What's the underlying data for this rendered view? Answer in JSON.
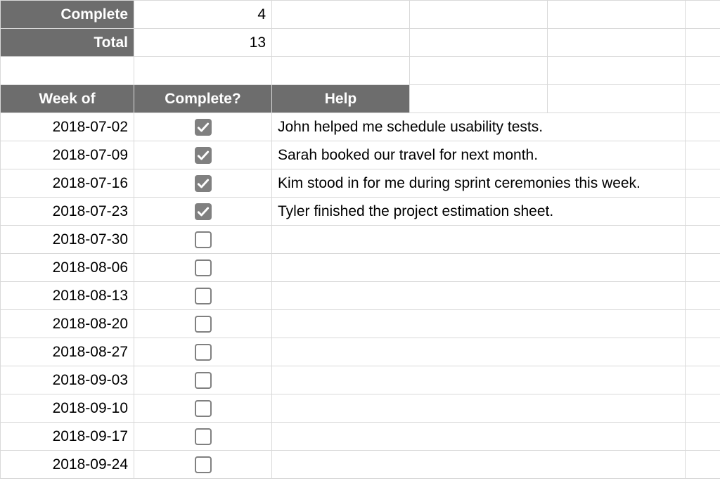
{
  "summary": {
    "complete_label": "Complete",
    "complete_value": "4",
    "total_label": "Total",
    "total_value": "13"
  },
  "headers": {
    "week_of": "Week of",
    "complete": "Complete?",
    "help": "Help"
  },
  "rows": [
    {
      "date": "2018-07-02",
      "checked": true,
      "help": "John helped me schedule usability tests."
    },
    {
      "date": "2018-07-09",
      "checked": true,
      "help": "Sarah booked our travel for next month."
    },
    {
      "date": "2018-07-16",
      "checked": true,
      "help": "Kim stood in for me during sprint ceremonies this week."
    },
    {
      "date": "2018-07-23",
      "checked": true,
      "help": "Tyler finished the project estimation sheet."
    },
    {
      "date": "2018-07-30",
      "checked": false,
      "help": ""
    },
    {
      "date": "2018-08-06",
      "checked": false,
      "help": ""
    },
    {
      "date": "2018-08-13",
      "checked": false,
      "help": ""
    },
    {
      "date": "2018-08-20",
      "checked": false,
      "help": ""
    },
    {
      "date": "2018-08-27",
      "checked": false,
      "help": ""
    },
    {
      "date": "2018-09-03",
      "checked": false,
      "help": ""
    },
    {
      "date": "2018-09-10",
      "checked": false,
      "help": ""
    },
    {
      "date": "2018-09-17",
      "checked": false,
      "help": ""
    },
    {
      "date": "2018-09-24",
      "checked": false,
      "help": ""
    }
  ]
}
